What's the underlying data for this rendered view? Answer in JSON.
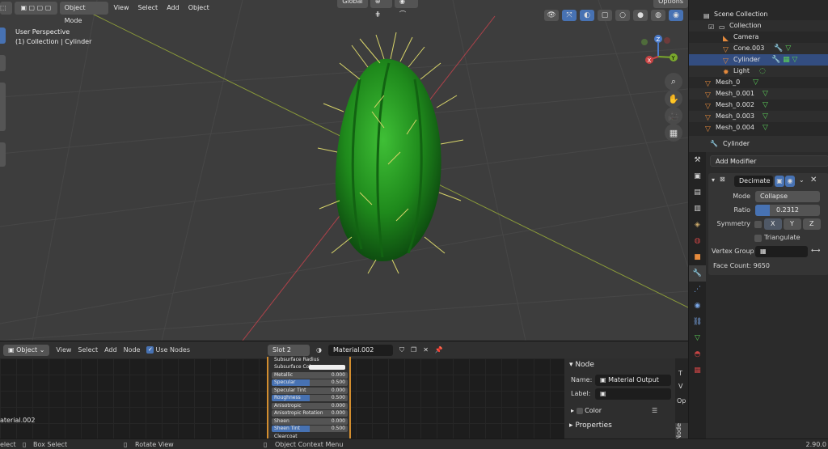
{
  "viewport": {
    "mode": "Object Mode",
    "menus": [
      "View",
      "Select",
      "Add",
      "Object"
    ],
    "transform_orientation": "Global",
    "options": "Options",
    "info_line1": "User Perspective",
    "info_line2": "(1) Collection | Cylinder",
    "axes": [
      "X",
      "Y",
      "Z"
    ]
  },
  "outliner": {
    "rows": [
      {
        "label": "Scene Collection",
        "icon": "scene-collection-icon"
      },
      {
        "label": "Collection",
        "icon": "collection-icon"
      },
      {
        "label": "Camera",
        "icon": "camera-icon"
      },
      {
        "label": "Cone.003",
        "icon": "mesh-object-icon"
      },
      {
        "label": "Cylinder",
        "icon": "mesh-object-icon"
      },
      {
        "label": "Light",
        "icon": "light-icon"
      },
      {
        "label": "Mesh_0",
        "icon": "mesh-object-icon"
      },
      {
        "label": "Mesh_0.001",
        "icon": "mesh-object-icon"
      },
      {
        "label": "Mesh_0.002",
        "icon": "mesh-object-icon"
      },
      {
        "label": "Mesh_0.003",
        "icon": "mesh-object-icon"
      },
      {
        "label": "Mesh_0.004",
        "icon": "mesh-object-icon"
      }
    ]
  },
  "properties": {
    "object_name": "Cylinder",
    "add_modifier": "Add Modifier",
    "modifier_name": "Decimate",
    "mode_label": "Mode",
    "mode_value": "Collapse",
    "ratio_label": "Ratio",
    "ratio_value": "0.2312",
    "ratio_fraction": 0.2312,
    "symmetry_label": "Symmetry",
    "sym_axes": [
      "X",
      "Y",
      "Z"
    ],
    "triangulate": "Triangulate",
    "vertex_group": "Vertex Group",
    "face_count": "Face Count: 9650"
  },
  "node_editor": {
    "mode": "Object",
    "menus": [
      "View",
      "Select",
      "Add",
      "Node"
    ],
    "use_nodes": "Use Nodes",
    "slot": "Slot 2",
    "material": "Material.002",
    "left_label": "aterial.002",
    "node_rows": [
      {
        "label": "Subsurface Radius",
        "value": ""
      },
      {
        "label": "Subsurface Color",
        "value": ""
      },
      {
        "label": "Metallic",
        "value": "0.000"
      },
      {
        "label": "Specular",
        "value": "0.500"
      },
      {
        "label": "Specular Tint",
        "value": "0.000"
      },
      {
        "label": "Roughness",
        "value": "0.500"
      },
      {
        "label": "Anisotropic",
        "value": "0.000"
      },
      {
        "label": "Anisotropic Rotation",
        "value": "0.000"
      },
      {
        "label": "Sheen",
        "value": "0.000"
      },
      {
        "label": "Sheen Tint",
        "value": "0.500"
      },
      {
        "label": "Clearcoat",
        "value": ""
      }
    ],
    "side_panel": {
      "title": "Node",
      "name_label": "Name:",
      "name_value": "Material Output",
      "label_label": "Label:",
      "color": "Color",
      "properties": "Properties"
    },
    "tabs": [
      "Node",
      "Op",
      "V",
      "T"
    ]
  },
  "status": {
    "select": "elect",
    "box_select": "Box Select",
    "rotate_view": "Rotate View",
    "context_menu": "Object Context Menu",
    "version": "2.90.0"
  }
}
